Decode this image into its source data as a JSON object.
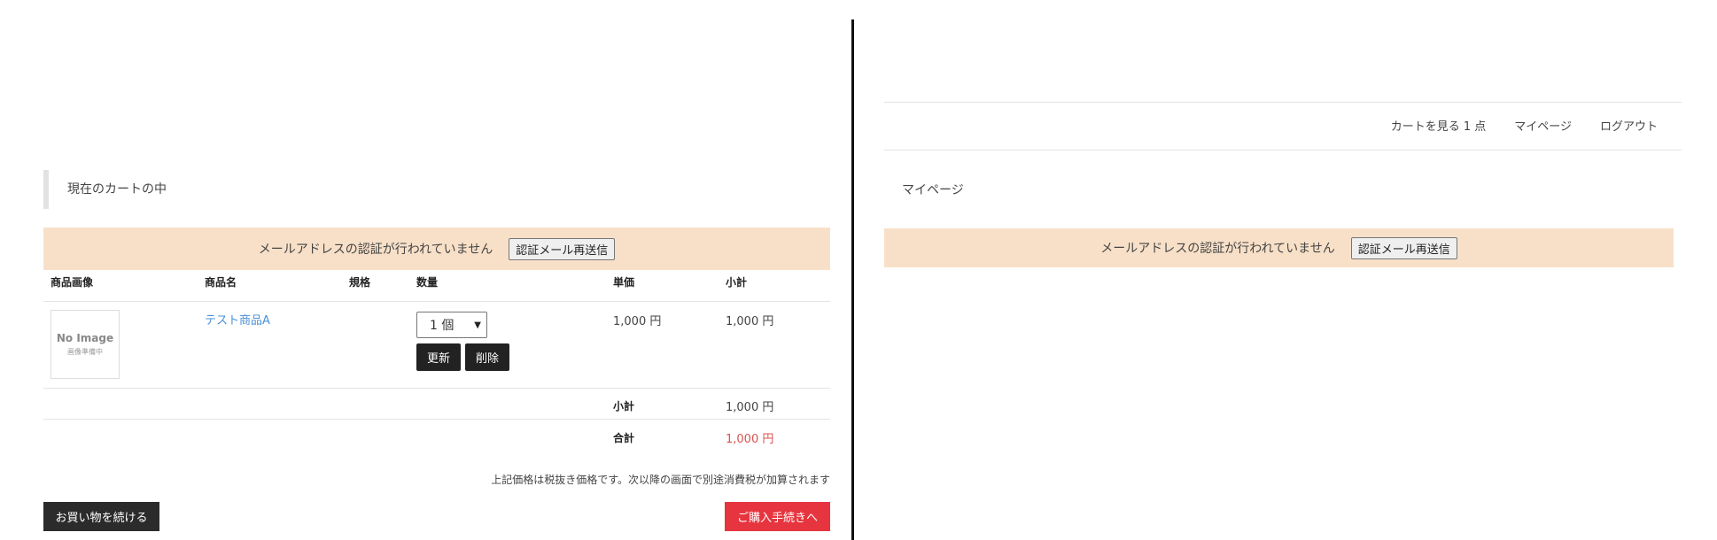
{
  "left": {
    "cart_heading": "現在のカートの中",
    "notice": {
      "message": "メールアドレスの認証が行われていません",
      "resend_label": "認証メール再送信"
    },
    "columns": {
      "image": "商品画像",
      "name": "商品名",
      "spec": "規格",
      "quantity": "数量",
      "unit_price": "単価",
      "subtotal": "小計"
    },
    "item": {
      "image_text": "No Image",
      "image_subtext": "画像準備中",
      "name": "テスト商品A",
      "spec": "",
      "quantity_selected": "1 個",
      "update_label": "更新",
      "delete_label": "削除",
      "unit_price": "1,000 円",
      "subtotal": "1,000 円"
    },
    "summary": {
      "subtotal_label": "小計",
      "subtotal_value": "1,000 円",
      "total_label": "合計",
      "total_value": "1,000 円",
      "total_color": "#d9534f"
    },
    "tax_note": "上記価格は税抜き価格です。次以降の画面で別途消費税が加算されます",
    "continue_label": "お買い物を続ける",
    "checkout_label": "ご購入手続きへ",
    "checkout_color": "#e6353f"
  },
  "right": {
    "nav": {
      "cart_label": "カートを見る 1 点",
      "mypage_label": "マイページ",
      "logout_label": "ログアウト"
    },
    "page_title": "マイページ",
    "notice": {
      "message": "メールアドレスの認証が行われていません",
      "resend_label": "認証メール再送信"
    }
  },
  "colors": {
    "notice_bg": "#f8e0c8",
    "link": "#4a90d9"
  }
}
